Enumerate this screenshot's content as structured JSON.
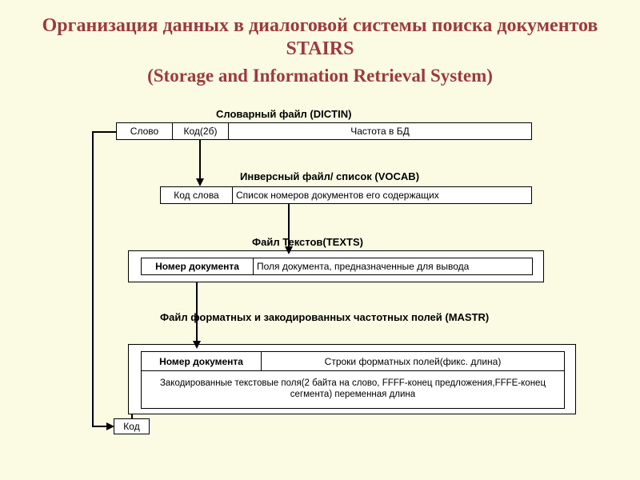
{
  "title": "Организация данных в диалоговой системы поиска документов STAIRS",
  "subtitle": "(Storage and Information Retrieval System)",
  "dictin": {
    "label": "Словарный файл (DICTIN)",
    "c1": "Слово",
    "c2": "Код(2б)",
    "c3": "Частота в БД"
  },
  "vocab": {
    "label": "Инверсный файл/ список (VOCAB)",
    "c1": "Код слова",
    "c2": "Список номеров документов его содержащих"
  },
  "texts": {
    "label": "Файл Текстов(TEXTS)",
    "c1": "Номер документа",
    "c2": "Поля документа, предназначенные для вывода"
  },
  "mastr": {
    "label": "Файл форматных и закодированных частотных полей (MASTR)",
    "r1c1": "Номер документа",
    "r1c2": "Строки форматных полей(фикс. длина)",
    "r2": "Закодированные текстовые поля(2 байта на слово, FFFF-конец предложения,FFFE-конец сегмента) переменная длина",
    "kod": "Код"
  }
}
